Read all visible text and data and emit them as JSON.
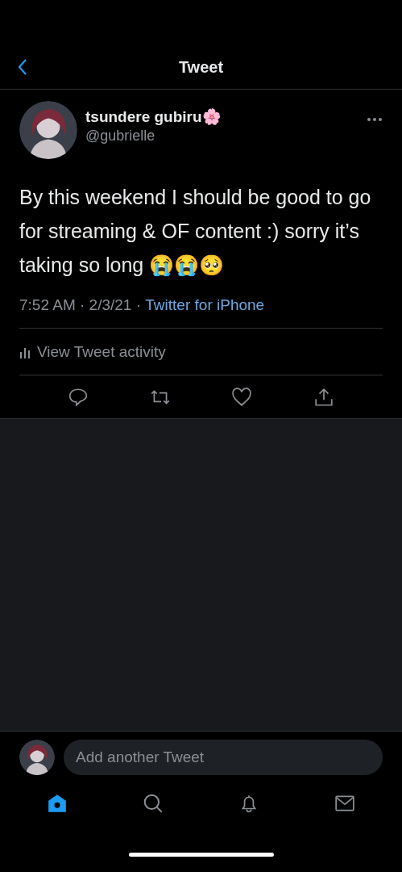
{
  "header": {
    "title": "Tweet"
  },
  "tweet": {
    "author": {
      "name": "tsundere gubiru🌸",
      "handle": "@gubrielle"
    },
    "text": "By this weekend I should be good to go for streaming & OF content :) sorry it’s taking so long 😭😭🥺",
    "timestamp": "7:52 AM · 2/3/21 · ",
    "source": "Twitter for iPhone",
    "activity": "View Tweet activity"
  },
  "reply": {
    "placeholder": "Add another Tweet"
  },
  "tab_bar": [
    {
      "kind": "home",
      "selected": true
    },
    {
      "kind": "search",
      "selected": false
    },
    {
      "kind": "notifications",
      "selected": false
    },
    {
      "kind": "messages",
      "selected": false
    }
  ]
}
